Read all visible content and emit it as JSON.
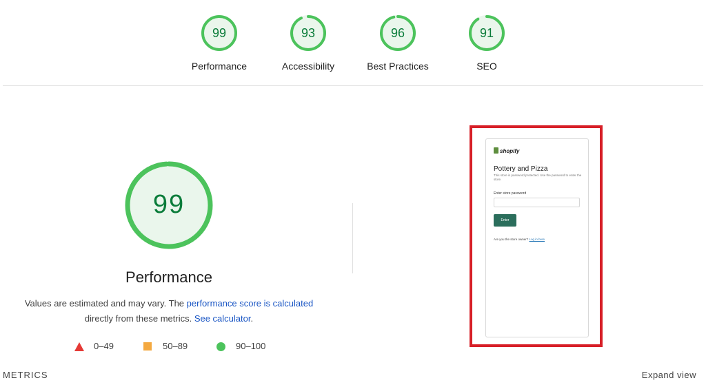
{
  "colors": {
    "pass": "#0a7c3a",
    "pass_ring": "#4cc35c",
    "pass_fill": "#eaf6ec",
    "highlight_border": "#d71f27",
    "link": "#1a56c4"
  },
  "summary_gauges": [
    {
      "score": "99",
      "label": "Performance",
      "value": 99
    },
    {
      "score": "93",
      "label": "Accessibility",
      "value": 93
    },
    {
      "score": "96",
      "label": "Best Practices",
      "value": 96
    },
    {
      "score": "91",
      "label": "SEO",
      "value": 91
    }
  ],
  "main_gauge": {
    "score": "99",
    "value": 99,
    "title": "Performance"
  },
  "description": {
    "text_1": "Values are estimated and may vary. The ",
    "link_1": "performance score is calculated",
    "text_2": "directly from these metrics. ",
    "link_2": "See calculator",
    "text_3": "."
  },
  "legend": [
    {
      "icon": "red-triangle-icon",
      "range": "0–49"
    },
    {
      "icon": "orange-square-icon",
      "range": "50–89"
    },
    {
      "icon": "green-circle-icon",
      "range": "90–100"
    }
  ],
  "screenshot": {
    "logo": "shopify",
    "store_title": "Pottery and Pizza",
    "store_desc": "This store is password protected. Use the password to enter the store.",
    "password_label": "Enter store password",
    "enter_button": "Enter",
    "owner_text": "Are you the store owner? ",
    "owner_link": "Log in here"
  },
  "footer": {
    "metrics_label": "METRICS",
    "expand_label": "Expand view"
  }
}
